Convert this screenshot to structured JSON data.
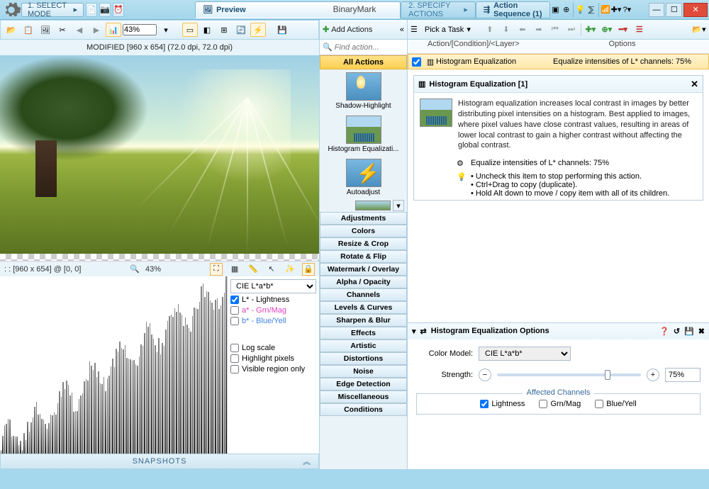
{
  "titlebar": {
    "app_name": "BinaryMark"
  },
  "topstrip": {
    "select_mode": "1. SELECT MODE",
    "tab_preview": "Preview",
    "tab_specify": "2. SPECIFY ACTIONS",
    "tab_sequence": "Action Sequence (1)"
  },
  "left": {
    "toolbar": {
      "zoom": "43%"
    },
    "imginfo": "MODIFIED [960 x 654] (72.0 dpi, 72.0 dpi)",
    "status": {
      "dims": ": : [960 x 654] @ [0, 0]",
      "zoom": "43%"
    },
    "hist": {
      "colorspace": "CIE L*a*b*",
      "ch_L": "L* - Lightness",
      "ch_a": "a* - Grn/Mag",
      "ch_b": "b* - Blue/Yell",
      "log": "Log scale",
      "highlight": "Highlight pixels",
      "visible": "Visible region only"
    },
    "snapshots": "SNAPSHOTS"
  },
  "mid": {
    "add_actions": "Add Actions",
    "search_ph": "Find action...",
    "all_actions": "All Actions",
    "tiles": {
      "shadow": "Shadow-Highlight",
      "histeq": "Histogram Equalizati...",
      "auto": "Autoadjust"
    },
    "cats": [
      "Adjustments",
      "Colors",
      "Resize & Crop",
      "Rotate & Flip",
      "Watermark / Overlay",
      "Alpha / Opacity",
      "Channels",
      "Levels & Curves",
      "Sharpen & Blur",
      "Effects",
      "Artistic",
      "Distortions",
      "Noise",
      "Edge Detection",
      "Miscellaneous",
      "Conditions"
    ]
  },
  "right": {
    "toolbar": {
      "pick_task": "Pick a Task"
    },
    "listhdr": {
      "c1": "Action/[Condition]/<Layer>",
      "c2": "Options"
    },
    "row": {
      "name": "Histogram Equalization",
      "opts": "Equalize intensities of L* channels: 75%"
    },
    "info": {
      "title": "Histogram Equalization [1]",
      "desc": "Histogram equalization increases local contrast in images by better distributing pixel intensities on a histogram. Best applied to images, where pixel values have close contrast values, resulting in areas of lower local contrast to gain a higher contrast without affecting the global contrast.",
      "summary": "Equalize intensities of L* channels: 75%",
      "tip1": "Uncheck this item to stop performing this action.",
      "tip2": "Ctrl+Drag to copy (duplicate).",
      "tip3": "Hold Alt down to move / copy item with all of its children."
    },
    "opts": {
      "title": "Histogram Equalization Options",
      "colormodel_lbl": "Color Model:",
      "colormodel": "CIE L*a*b*",
      "strength_lbl": "Strength:",
      "strength": "75%",
      "affected": "Affected Channels",
      "ch_L": "Lightness",
      "ch_gm": "Grn/Mag",
      "ch_by": "Blue/Yell"
    }
  }
}
